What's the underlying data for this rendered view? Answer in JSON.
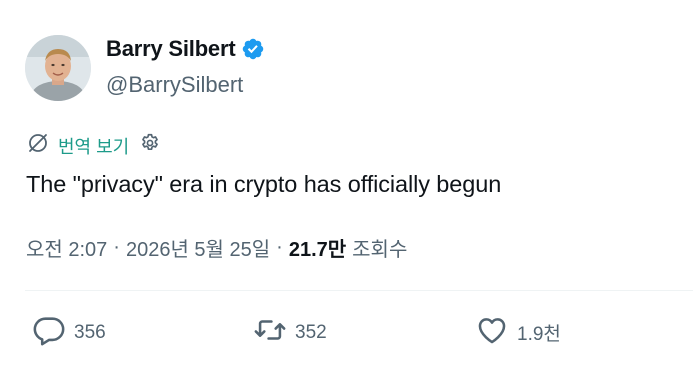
{
  "author": {
    "display_name": "Barry Silbert",
    "handle": "@BarrySilbert",
    "verified": true
  },
  "translate": {
    "label": "번역 보기"
  },
  "tweet": {
    "text": "The \"privacy\" era in crypto has officially begun"
  },
  "meta": {
    "time": "오전 2:07",
    "separator": "·",
    "date": "2026년 5월 25일",
    "views_count": "21.7만",
    "views_label": "조회수"
  },
  "actions": {
    "replies": "356",
    "retweets": "352",
    "likes": "1.9천"
  },
  "colors": {
    "verified": "#1d9bf0",
    "translate_accent": "#1d9b8a",
    "secondary_text": "#536471",
    "primary_text": "#0f1419"
  },
  "icons": {
    "verified": "verified-badge-icon",
    "translate": "translate-icon",
    "settings": "gear-icon",
    "reply": "reply-icon",
    "retweet": "retweet-icon",
    "like": "heart-icon"
  }
}
